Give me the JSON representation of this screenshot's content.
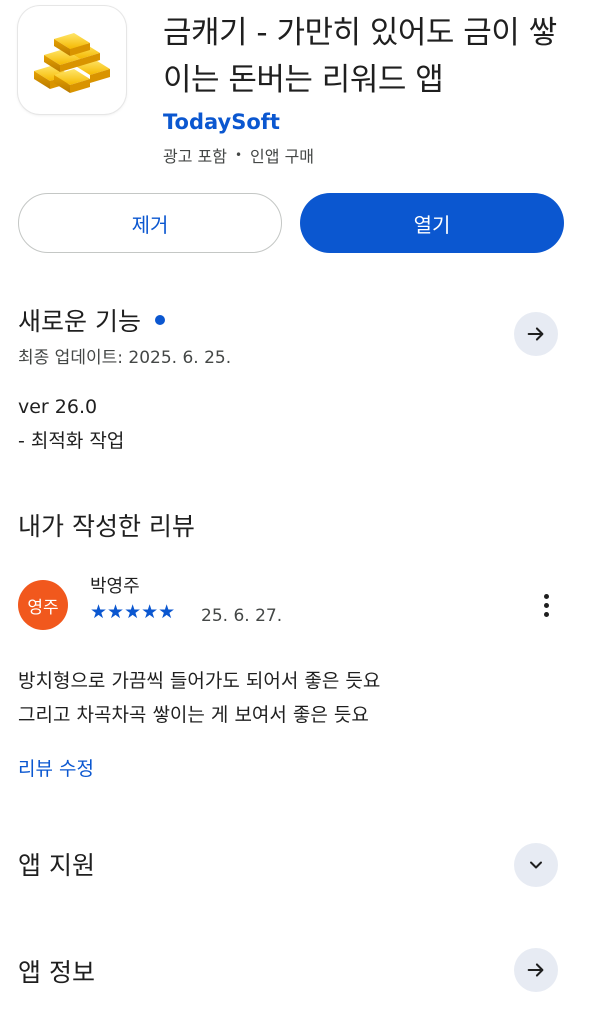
{
  "app": {
    "title": "금캐기 - 가만히 있어도 금이 쌓이는 돈버는 리워드 앱",
    "developer": "TodaySoft",
    "meta_ads": "광고 포함",
    "meta_separator": "•",
    "meta_iap": "인앱 구매",
    "icon": "gold-bars-icon"
  },
  "buttons": {
    "remove_label": "제거",
    "open_label": "열기"
  },
  "whats_new": {
    "title": "새로운 기능",
    "updated": "최종 업데이트: 2025. 6. 25.",
    "version": "ver 26.0",
    "notes": "- 최적화 작업"
  },
  "my_review": {
    "section_title": "내가 작성한 리뷰",
    "avatar_text": "영주",
    "reviewer_name": "박영주",
    "rating": 5,
    "stars": "★★★★★",
    "date": "25. 6. 27.",
    "text_line1": "방치형으로 가끔씩 들어가도 되어서 좋은 듯요",
    "text_line2": "그리고 차곡차곡 쌓이는 게 보여서 좋은 듯요",
    "edit_label": "리뷰 수정"
  },
  "app_support": {
    "title": "앱 지원"
  },
  "app_info": {
    "title": "앱 정보"
  },
  "colors": {
    "accent": "#0b57d0",
    "avatar": "#f1581d",
    "round_button": "#e7ebf3"
  }
}
